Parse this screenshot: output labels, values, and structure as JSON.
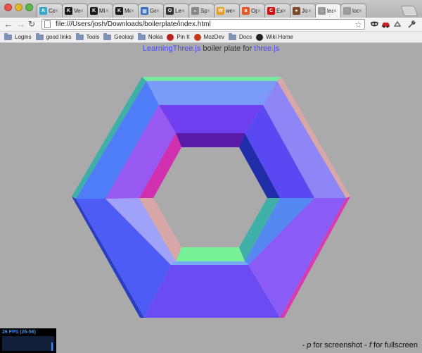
{
  "tabs": [
    {
      "label": "Ca",
      "icon": "tab-icon-a",
      "color": "#3aa7c9",
      "glyph": "A",
      "active": false
    },
    {
      "label": "Ve",
      "icon": "tab-icon-k",
      "color": "#1a1a1a",
      "glyph": "K",
      "active": false
    },
    {
      "label": "Mi",
      "icon": "tab-icon-k",
      "color": "#1a1a1a",
      "glyph": "K",
      "active": false
    },
    {
      "label": "Mc",
      "icon": "tab-icon-k",
      "color": "#1a1a1a",
      "glyph": "K",
      "active": false
    },
    {
      "label": "Ge",
      "icon": "tab-icon-grid",
      "color": "#3b6fb5",
      "glyph": "▦",
      "active": false
    },
    {
      "label": "Le",
      "icon": "tab-icon-o",
      "color": "#333333",
      "glyph": "O",
      "active": false
    },
    {
      "label": "Sp",
      "icon": "tab-icon-car",
      "color": "#888888",
      "glyph": "◒",
      "active": false
    },
    {
      "label": "we",
      "icon": "tab-icon-w",
      "color": "#e2a12a",
      "glyph": "W",
      "active": false
    },
    {
      "label": "Op",
      "icon": "tab-icon-aro",
      "color": "#e55a2a",
      "glyph": "a",
      "active": false
    },
    {
      "label": "Ex",
      "icon": "tab-icon-cnn",
      "color": "#cc1111",
      "glyph": "C",
      "active": false
    },
    {
      "label": "Jo",
      "icon": "tab-icon-avatar",
      "color": "#7a4a2a",
      "glyph": "●",
      "active": false
    },
    {
      "label": "lea",
      "icon": "tab-icon-page",
      "color": "#999999",
      "glyph": "◌",
      "active": true
    },
    {
      "label": "loc",
      "icon": "tab-icon-page",
      "color": "#999999",
      "glyph": "◌",
      "active": false
    }
  ],
  "toolbar": {
    "url": "file:///Users/josh/Downloads/boilerplate/index.html"
  },
  "bookmarks": [
    {
      "label": "Logins",
      "icon": "folder-icon"
    },
    {
      "label": "good links",
      "icon": "folder-icon"
    },
    {
      "label": "Tools",
      "icon": "folder-icon"
    },
    {
      "label": "Geoloqi",
      "icon": "folder-icon"
    },
    {
      "label": "Nokia",
      "icon": "folder-icon"
    },
    {
      "label": "Pin It",
      "icon": "pin-icon"
    },
    {
      "label": "MozDev",
      "icon": "moz-icon"
    },
    {
      "label": "Docs",
      "icon": "folder-icon"
    },
    {
      "label": "Wiki Home",
      "icon": "wiki-icon"
    }
  ],
  "page": {
    "info_link1": "LearningThree.js",
    "info_middle": " boiler plate for ",
    "info_link2": "three.js",
    "stats": "26 FPS (26-56)",
    "help_dash1": "- ",
    "help_key1": "p",
    "help_text1": " for screenshot - ",
    "help_key2": "f",
    "help_text2": " for fullscreen"
  },
  "scene": {
    "background": "#aaaaaa",
    "faces": [
      {
        "name": "outer-rim-top",
        "color": "#7a9cf8"
      },
      {
        "name": "outer-rim-upper-right",
        "color": "#8e86f7"
      },
      {
        "name": "outer-rim-lower-right",
        "color": "#8b5cf5"
      },
      {
        "name": "outer-rim-bottom",
        "color": "#6b4cf2"
      },
      {
        "name": "outer-rim-lower-left",
        "color": "#4c5cf5"
      },
      {
        "name": "outer-rim-upper-left",
        "color": "#4f7cf7"
      },
      {
        "name": "inner-top",
        "color": "#7040f0"
      },
      {
        "name": "inner-upper-right",
        "color": "#5a48f2"
      },
      {
        "name": "inner-lower-right",
        "color": "#5588f0"
      },
      {
        "name": "inner-bottom",
        "color": "#77aaf5"
      },
      {
        "name": "inner-lower-left",
        "color": "#9fa2f8"
      },
      {
        "name": "inner-upper-left",
        "color": "#9858f2"
      }
    ]
  }
}
